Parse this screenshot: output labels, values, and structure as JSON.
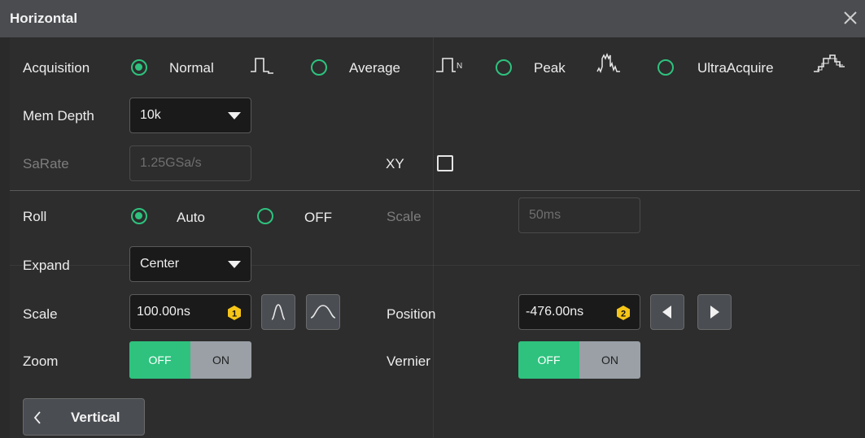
{
  "window": {
    "title": "Horizontal"
  },
  "acquisition": {
    "label": "Acquisition",
    "options": [
      {
        "label": "Normal",
        "checked": true,
        "icon": "normal-wave-icon"
      },
      {
        "label": "Average",
        "checked": false,
        "icon": "average-wave-icon"
      },
      {
        "label": "Peak",
        "checked": false,
        "icon": "peak-wave-icon"
      },
      {
        "label": "UltraAcquire",
        "checked": false,
        "icon": "ultraacquire-wave-icon"
      }
    ]
  },
  "mem_depth": {
    "label": "Mem Depth",
    "value": "10k"
  },
  "sa_rate": {
    "label": "SaRate",
    "value": "1.25GSa/s"
  },
  "xy": {
    "label": "XY",
    "checked": false
  },
  "roll": {
    "label": "Roll",
    "options": [
      {
        "label": "Auto",
        "checked": true
      },
      {
        "label": "OFF",
        "checked": false
      }
    ]
  },
  "roll_scale": {
    "label": "Scale",
    "value": "50ms"
  },
  "expand": {
    "label": "Expand",
    "value": "Center"
  },
  "scale": {
    "label": "Scale",
    "value": "100.00ns",
    "knob": "1"
  },
  "position": {
    "label": "Position",
    "value": "-476.00ns",
    "knob": "2"
  },
  "zoom": {
    "label": "Zoom",
    "off_label": "OFF",
    "on_label": "ON",
    "state": "OFF"
  },
  "vernier": {
    "label": "Vernier",
    "off_label": "OFF",
    "on_label": "ON",
    "state": "OFF"
  },
  "nav": {
    "back_label": "Vertical"
  },
  "colors": {
    "accent": "#2ec27e",
    "knob": "#f5c518",
    "title_bg": "#4a4c50",
    "panel_bg": "#2d2d2d"
  }
}
